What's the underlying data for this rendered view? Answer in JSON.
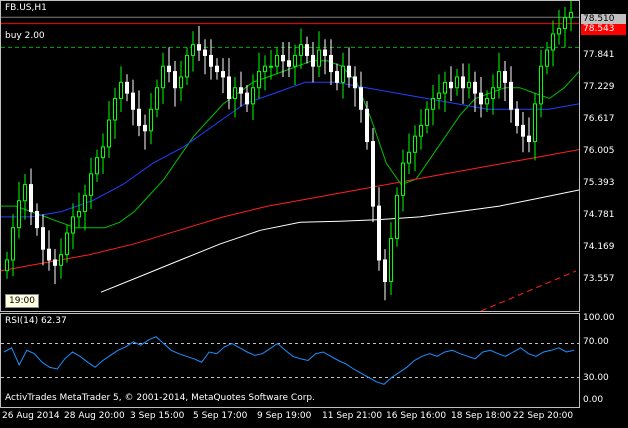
{
  "chart_data": [
    {
      "type": "candlestick",
      "title": "FB.US,H1",
      "series": [
        {
          "name": "price",
          "values": [
            74.0,
            74.6,
            75.1,
            75.4,
            74.9,
            74.6,
            74.2,
            74.0,
            73.9,
            74.1,
            74.5,
            74.8,
            74.9,
            75.2,
            75.6,
            75.9,
            76.1,
            76.6,
            77.0,
            77.3,
            77.1,
            76.8,
            76.5,
            76.4,
            76.8,
            77.2,
            77.6,
            77.5,
            77.2,
            77.4,
            77.8,
            78.0,
            77.9,
            77.8,
            77.6,
            77.5,
            77.4,
            77.0,
            77.2,
            77.1,
            76.9,
            77.2,
            77.5,
            77.6,
            77.6,
            77.8,
            77.7,
            77.6,
            77.8,
            78.0,
            77.8,
            77.6,
            77.9,
            77.8,
            77.5,
            77.3,
            77.6,
            77.4,
            77.2,
            76.8,
            76.2,
            75.0,
            74.0,
            73.6,
            74.4,
            75.2,
            75.8,
            76.0,
            76.3,
            76.5,
            76.8,
            77.0,
            77.1,
            77.3,
            77.2,
            77.4,
            77.2,
            77.3,
            77.1,
            76.9,
            77.0,
            77.2,
            77.5,
            77.3,
            76.8,
            76.5,
            76.3,
            76.2,
            76.9,
            77.6,
            77.9,
            78.2,
            78.3,
            78.5,
            78.6
          ]
        },
        {
          "name": "MA fast (green)",
          "values": [
            75.0,
            75.0,
            74.9,
            74.8,
            74.7,
            74.6,
            74.6,
            74.6,
            74.7,
            74.9,
            75.2,
            75.5,
            75.9,
            76.3,
            76.6,
            76.9,
            77.1,
            77.3,
            77.4,
            77.5,
            77.6,
            77.7,
            77.7,
            77.6,
            77.3,
            76.6,
            75.8,
            75.4,
            75.5,
            75.9,
            76.3,
            76.7,
            77.0,
            77.1,
            77.2,
            77.2,
            77.1,
            77.0,
            77.2,
            77.5
          ]
        },
        {
          "name": "MA medium (blue)",
          "values": [
            74.8,
            74.8,
            74.9,
            75.1,
            75.4,
            75.8,
            76.1,
            76.5,
            76.9,
            77.1,
            77.3,
            77.3,
            77.2,
            77.1,
            77.0,
            76.9,
            76.8,
            76.8,
            76.8,
            76.9
          ]
        },
        {
          "name": "MA slow (red)",
          "values": [
            73.8,
            73.95,
            74.1,
            74.3,
            74.55,
            74.8,
            75.0,
            75.15,
            75.3,
            75.45,
            75.6,
            75.75,
            75.9,
            76.05
          ]
        },
        {
          "name": "MA slowest (white)",
          "values": [
            73.4,
            73.7,
            74.0,
            74.3,
            74.55,
            74.7,
            74.72,
            74.75,
            74.8,
            74.9,
            75.0,
            75.15,
            75.3
          ]
        }
      ],
      "x_tick_labels": [
        "26 Aug 2014",
        "28 Aug 20:00",
        "3 Sep 15:00",
        "5 Sep 17:00",
        "9 Sep 19:00",
        "11 Sep 21:00",
        "16 Sep 16:00",
        "18 Sep 18:00",
        "22 Sep 20:00"
      ],
      "y_tick_labels": [
        "77.841",
        "77.229",
        "76.617",
        "76.005",
        "75.393",
        "74.781",
        "74.169",
        "73.557"
      ],
      "ylim": [
        73.2,
        78.7
      ],
      "price_labels": {
        "bid": "78.510",
        "ask": "78.543"
      },
      "order_line": {
        "label": "buy 2.00",
        "price": 77.95
      },
      "grid": false
    },
    {
      "type": "line",
      "title": "RSI(14) 62.37",
      "series": [
        {
          "name": "RSI(14)",
          "values": [
            60,
            65,
            45,
            62,
            58,
            48,
            42,
            40,
            52,
            60,
            55,
            48,
            42,
            50,
            56,
            62,
            66,
            72,
            68,
            74,
            78,
            70,
            62,
            58,
            55,
            52,
            48,
            60,
            58,
            66,
            70,
            65,
            60,
            56,
            58,
            64,
            70,
            62,
            55,
            52,
            50,
            58,
            60,
            55,
            50,
            46,
            40,
            35,
            30,
            25,
            22,
            30,
            36,
            42,
            50,
            55,
            58,
            55,
            60,
            62,
            58,
            55,
            52,
            60,
            62,
            58,
            55,
            60,
            65,
            58,
            55,
            60,
            62,
            65,
            60,
            62
          ]
        }
      ],
      "levels": [
        70,
        30
      ],
      "ylim": [
        0,
        100
      ],
      "y_tick_labels": [
        "100.00",
        "70.00",
        "30.00",
        "0.00"
      ]
    }
  ],
  "indicator_title": "RSI(14) 62.37",
  "order_label": "buy 2.00",
  "time_box": "19:00",
  "footer_text": "ActivTrades MetaTrader 5, © 2001-2014, MetaQuotes Software Corp.",
  "colors": {
    "bull": "#00ff00",
    "bear": "#ffffff",
    "bid_bg": "#c0c0c0",
    "ask_bg": "#ff0000",
    "rsi": "#1e90ff"
  }
}
